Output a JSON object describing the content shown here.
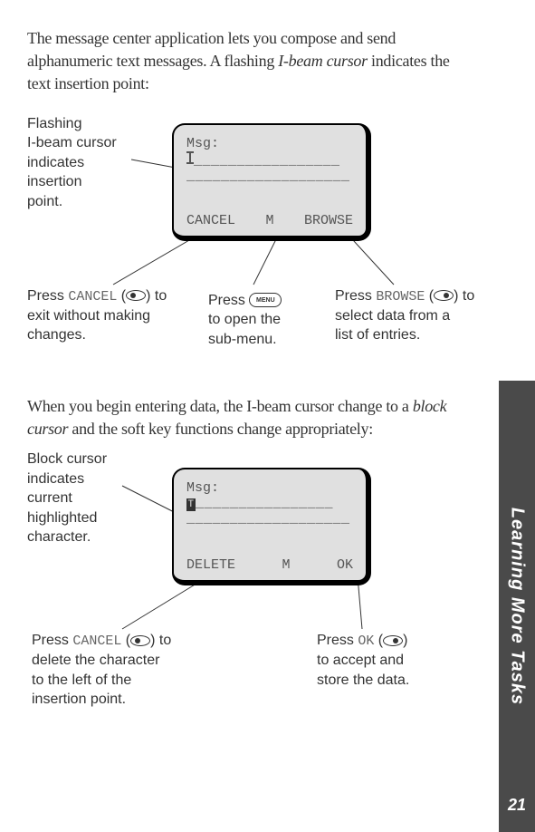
{
  "intro": {
    "part1": "The message center application lets you compose and send alphanumeric text messages. A flashing ",
    "italic": "I-beam cursor",
    "part2": " indicates the text insertion point:"
  },
  "section2": {
    "part1": "When you begin entering data, the I-beam cursor change to a ",
    "italic": "block cursor",
    "part2": " and the soft key functions change appropriately:"
  },
  "screen1": {
    "title": "Msg:",
    "line_underscores": "_________________",
    "line2_underscores": "___________________",
    "soft_left": "CANCEL",
    "soft_mid": "M",
    "soft_right": "BROWSE"
  },
  "screen2": {
    "title": "Msg:",
    "block_char": "T",
    "line_underscores": "________________",
    "line2_underscores": "___________________",
    "soft_left": "DELETE",
    "soft_mid": "M",
    "soft_right": "OK"
  },
  "callouts1": {
    "cursor": {
      "l1": "Flashing",
      "l2_italic": "I-beam cursor",
      "l3": "indicates",
      "l4": "insertion",
      "l5": "point."
    },
    "cancel": {
      "pre": "Press ",
      "key": "CANCEL",
      "mid": " (",
      "post": ") to",
      "l2": "exit without making",
      "l3": "changes."
    },
    "menu": {
      "pre": "Press ",
      "l2": "to open the",
      "l3": "sub-menu."
    },
    "browse": {
      "pre": "Press ",
      "key": "BROWSE",
      "mid": " (",
      "post": ") to",
      "l2": "select data from a",
      "l3": "list of entries."
    }
  },
  "callouts2": {
    "cursor": {
      "l1_bold": "Block cursor",
      "l2": "indicates",
      "l3": "current",
      "l4": "highlighted",
      "l5": "character."
    },
    "delete": {
      "pre": "Press ",
      "key": "CANCEL",
      "mid": " (",
      "post": ") to",
      "l2": "delete the character",
      "l3": "to the left of the",
      "l4": "insertion point."
    },
    "ok": {
      "pre": "Press ",
      "key": "OK",
      "mid": " (",
      "post": ")",
      "l2": "to accept and",
      "l3": "store the data."
    }
  },
  "menu_key_label": "MENU",
  "side_tab": "Learning More Tasks",
  "page_number": "21"
}
